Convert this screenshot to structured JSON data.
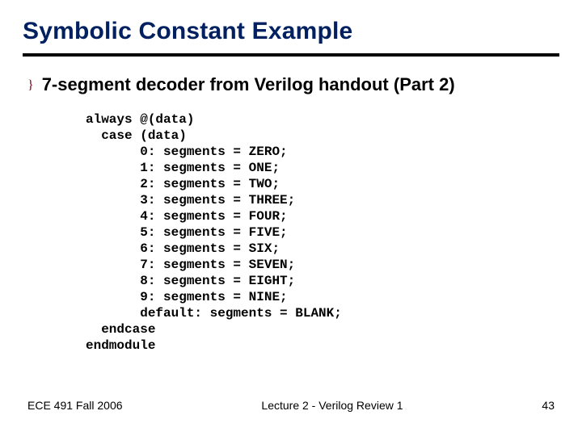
{
  "title": "Symbolic Constant Example",
  "bullet_icon": "}",
  "body": "7-segment decoder from Verilog handout (Part 2)",
  "code": "always @(data)\n  case (data)\n       0: segments = ZERO;\n       1: segments = ONE;\n       2: segments = TWO;\n       3: segments = THREE;\n       4: segments = FOUR;\n       5: segments = FIVE;\n       6: segments = SIX;\n       7: segments = SEVEN;\n       8: segments = EIGHT;\n       9: segments = NINE;\n       default: segments = BLANK;\n  endcase\nendmodule",
  "footer": {
    "left": "ECE 491 Fall 2006",
    "center": "Lecture 2 - Verilog Review 1",
    "right": "43"
  }
}
